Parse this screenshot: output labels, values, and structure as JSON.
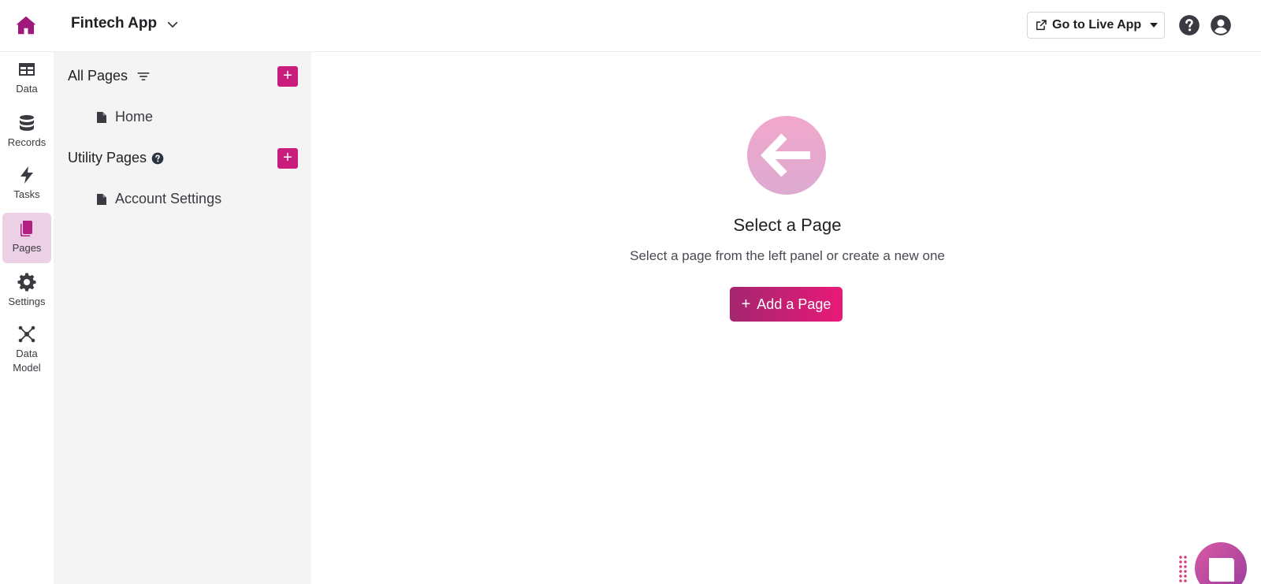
{
  "header": {
    "app_title": "Fintech App",
    "live_button_label": "Go to Live App"
  },
  "rail": {
    "items": [
      {
        "label": "Data",
        "icon": "table-icon"
      },
      {
        "label": "Records",
        "icon": "database-icon"
      },
      {
        "label": "Tasks",
        "icon": "bolt-icon"
      },
      {
        "label": "Pages",
        "icon": "pages-icon",
        "active": true
      },
      {
        "label": "Settings",
        "icon": "gear-icon"
      },
      {
        "label": "Data Model",
        "icon": "network-icon"
      }
    ]
  },
  "panel": {
    "all_pages": {
      "title": "All Pages",
      "items": [
        "Home"
      ]
    },
    "utility_pages": {
      "title": "Utility Pages",
      "items": [
        "Account Settings"
      ]
    },
    "add_symbol": "+"
  },
  "main": {
    "title": "Select a Page",
    "subtitle": "Select a page from the left panel or create a new one",
    "add_button_label": "Add a Page",
    "add_button_symbol": "+"
  },
  "colors": {
    "accent": "#c81d7c",
    "active_bg": "#ecd0e6",
    "panel_bg": "#f4f4f5"
  }
}
